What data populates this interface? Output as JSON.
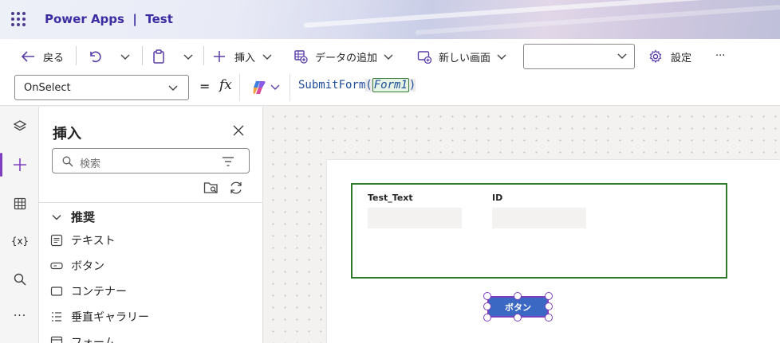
{
  "header": {
    "app_name": "Power Apps",
    "separator": "|",
    "app_title": "Test"
  },
  "toolbar": {
    "back_label": "戻る",
    "insert_label": "挿入",
    "add_data_label": "データの追加",
    "new_screen_label": "新しい画面",
    "screen_dropdown_value": "",
    "settings_label": "設定",
    "more_label": "···"
  },
  "formula_bar": {
    "property": "OnSelect",
    "equals": "=",
    "fx": "fx",
    "function_name": "SubmitForm",
    "open_paren": "(",
    "argument": "Form1",
    "close_paren": ")"
  },
  "insert_panel": {
    "title": "挿入",
    "search_placeholder": "検索",
    "section_title": "推奨",
    "items": [
      {
        "label": "テキスト",
        "icon": "text-icon"
      },
      {
        "label": "ボタン",
        "icon": "button-icon"
      },
      {
        "label": "コンテナー",
        "icon": "container-icon"
      },
      {
        "label": "垂直ギャラリー",
        "icon": "gallery-icon"
      },
      {
        "label": "フォーム",
        "icon": "form-icon"
      }
    ]
  },
  "canvas": {
    "form_fields": [
      {
        "label": "Test_Text",
        "value": ""
      },
      {
        "label": "ID",
        "value": ""
      }
    ],
    "button_label": "ボタン"
  },
  "colors": {
    "brand_purple": "#3b2ea0",
    "selection_purple": "#7d3fbf",
    "form_border_green": "#2a7a2a",
    "button_blue": "#3a68c2"
  }
}
